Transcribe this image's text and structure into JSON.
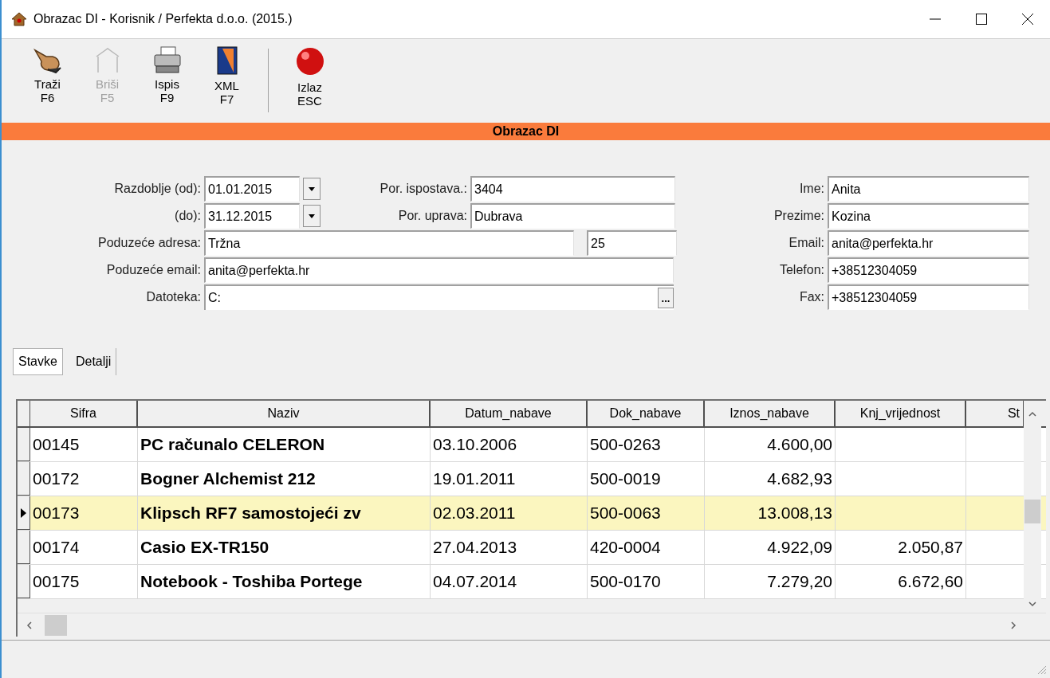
{
  "window": {
    "title": "Obrazac DI - Korisnik / Perfekta d.o.o. (2015.)"
  },
  "toolbar": [
    {
      "kind": "search",
      "label": "Traži",
      "key": "F6",
      "disabled": false
    },
    {
      "kind": "delete",
      "label": "Briši",
      "key": "F5",
      "disabled": true
    },
    {
      "kind": "print",
      "label": "Ispis",
      "key": "F9",
      "disabled": false
    },
    {
      "kind": "xml",
      "label": "XML",
      "key": "F7",
      "disabled": false
    },
    {
      "kind": "exit",
      "label": "Izlaz",
      "key": "ESC",
      "disabled": false
    }
  ],
  "banner": "Obrazac DI",
  "form": {
    "period_from": {
      "label": "Razdoblje (od):",
      "value": "01.01.2015"
    },
    "period_to": {
      "label": "(do):",
      "value": "31.12.2015"
    },
    "tax_office": {
      "label": "Por. ispostava.:",
      "value": "3404"
    },
    "tax_admin": {
      "label": "Por. uprava:",
      "value": "Dubrava"
    },
    "address": {
      "label": "Poduzeće adresa:",
      "value": "Tržna",
      "number": "25"
    },
    "company_email": {
      "label": "Poduzeće email:",
      "value": "anita@perfekta.hr"
    },
    "file": {
      "label": "Datoteka:",
      "value": "C:",
      "browse": "..."
    },
    "contact": [
      {
        "label": "Ime:",
        "value": "Anita"
      },
      {
        "label": "Prezime:",
        "value": "Kozina"
      },
      {
        "label": "Email:",
        "value": "anita@perfekta.hr"
      },
      {
        "label": "Telefon:",
        "value": "+38512304059"
      },
      {
        "label": "Fax:",
        "value": "+38512304059"
      }
    ]
  },
  "tabs": [
    {
      "label": "Stavke",
      "selected": true
    },
    {
      "label": "Detalji",
      "selected": false
    }
  ],
  "table": {
    "columns": [
      "Sifra",
      "Naziv",
      "Datum_nabave",
      "Dok_nabave",
      "Iznos_nabave",
      "Knj_vrijednost",
      "St"
    ],
    "rows": [
      {
        "selected": false,
        "cells": [
          "00145",
          "PC računalo CELERON",
          "03.10.2006",
          "500-0263",
          "4.600,00",
          "",
          ""
        ]
      },
      {
        "selected": false,
        "cells": [
          "00172",
          "Bogner Alchemist 212",
          "19.01.2011",
          "500-0019",
          "4.682,93",
          "",
          ""
        ]
      },
      {
        "selected": true,
        "cells": [
          "00173",
          "Klipsch RF7 samostojeći zv",
          "02.03.2011",
          "500-0063",
          "13.008,13",
          "",
          ""
        ]
      },
      {
        "selected": false,
        "cells": [
          "00174",
          "Casio EX-TR150",
          "27.04.2013",
          "420-0004",
          "4.922,09",
          "2.050,87",
          ""
        ]
      },
      {
        "selected": false,
        "cells": [
          "00175",
          "Notebook - Toshiba Portege",
          "04.07.2014",
          "500-0170",
          "7.279,20",
          "6.672,60",
          ""
        ]
      }
    ]
  }
}
